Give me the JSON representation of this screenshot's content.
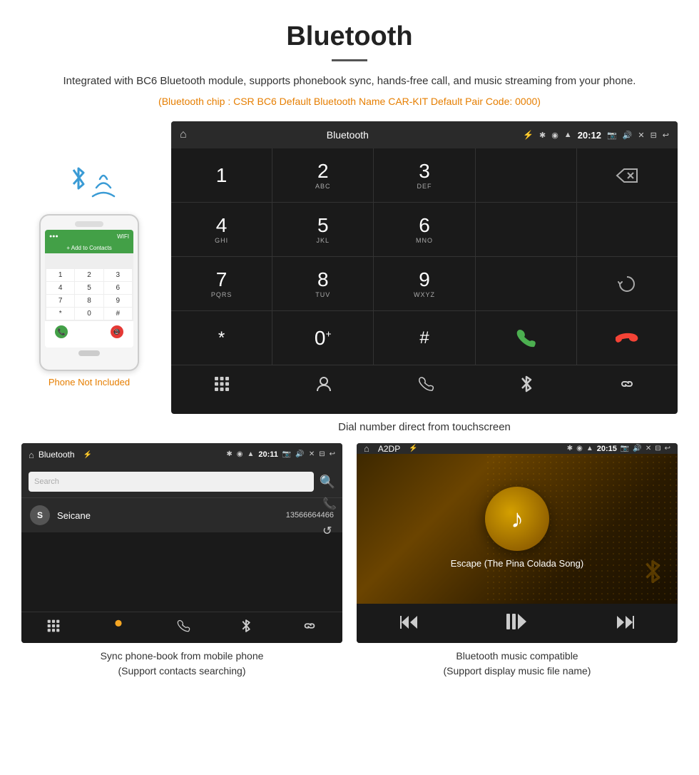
{
  "header": {
    "title": "Bluetooth",
    "description": "Integrated with BC6 Bluetooth module, supports phonebook sync, hands-free call, and music streaming from your phone.",
    "orange_info": "(Bluetooth chip : CSR BC6    Default Bluetooth Name CAR-KIT    Default Pair Code: 0000)"
  },
  "phone_label": "Phone Not Included",
  "car_dial": {
    "status_title": "Bluetooth",
    "status_time": "20:12",
    "keys": [
      {
        "number": "1",
        "letters": ""
      },
      {
        "number": "2",
        "letters": "ABC"
      },
      {
        "number": "3",
        "letters": "DEF"
      },
      {
        "number": "",
        "letters": ""
      },
      {
        "number": "⌫",
        "letters": ""
      },
      {
        "number": "4",
        "letters": "GHI"
      },
      {
        "number": "5",
        "letters": "JKL"
      },
      {
        "number": "6",
        "letters": "MNO"
      },
      {
        "number": "",
        "letters": ""
      },
      {
        "number": "",
        "letters": ""
      },
      {
        "number": "7",
        "letters": "PQRS"
      },
      {
        "number": "8",
        "letters": "TUV"
      },
      {
        "number": "9",
        "letters": "WXYZ"
      },
      {
        "number": "",
        "letters": ""
      },
      {
        "number": "↺",
        "letters": ""
      },
      {
        "number": "*",
        "letters": ""
      },
      {
        "number": "0",
        "letters": "+"
      },
      {
        "number": "#",
        "letters": ""
      },
      {
        "number": "📞",
        "letters": ""
      },
      {
        "number": "📵",
        "letters": ""
      }
    ]
  },
  "dial_caption": "Dial number direct from touchscreen",
  "phonebook": {
    "status_title": "Bluetooth",
    "status_time": "20:11",
    "search_placeholder": "Search",
    "contact_name": "Seicane",
    "contact_phone": "13566664466",
    "contact_initial": "S"
  },
  "music": {
    "status_title": "A2DP",
    "status_time": "20:15",
    "song_title": "Escape (The Pina Colada Song)"
  },
  "captions": {
    "phonebook": "Sync phone-book from mobile phone\n(Support contacts searching)",
    "music": "Bluetooth music compatible\n(Support display music file name)"
  },
  "icons": {
    "home": "⌂",
    "bluetooth": "✱",
    "usb": "⚡",
    "gps": "◉",
    "wifi": "▲",
    "camera": "📷",
    "volume": "🔊",
    "close": "✕",
    "screen": "⊟",
    "back": "↩",
    "keypad": "⊞",
    "person": "👤",
    "phone": "📞",
    "bt": "✱",
    "link": "🔗",
    "search": "🔍",
    "refresh": "↺",
    "prev": "⏮",
    "playpause": "⏯",
    "next": "⏭"
  }
}
